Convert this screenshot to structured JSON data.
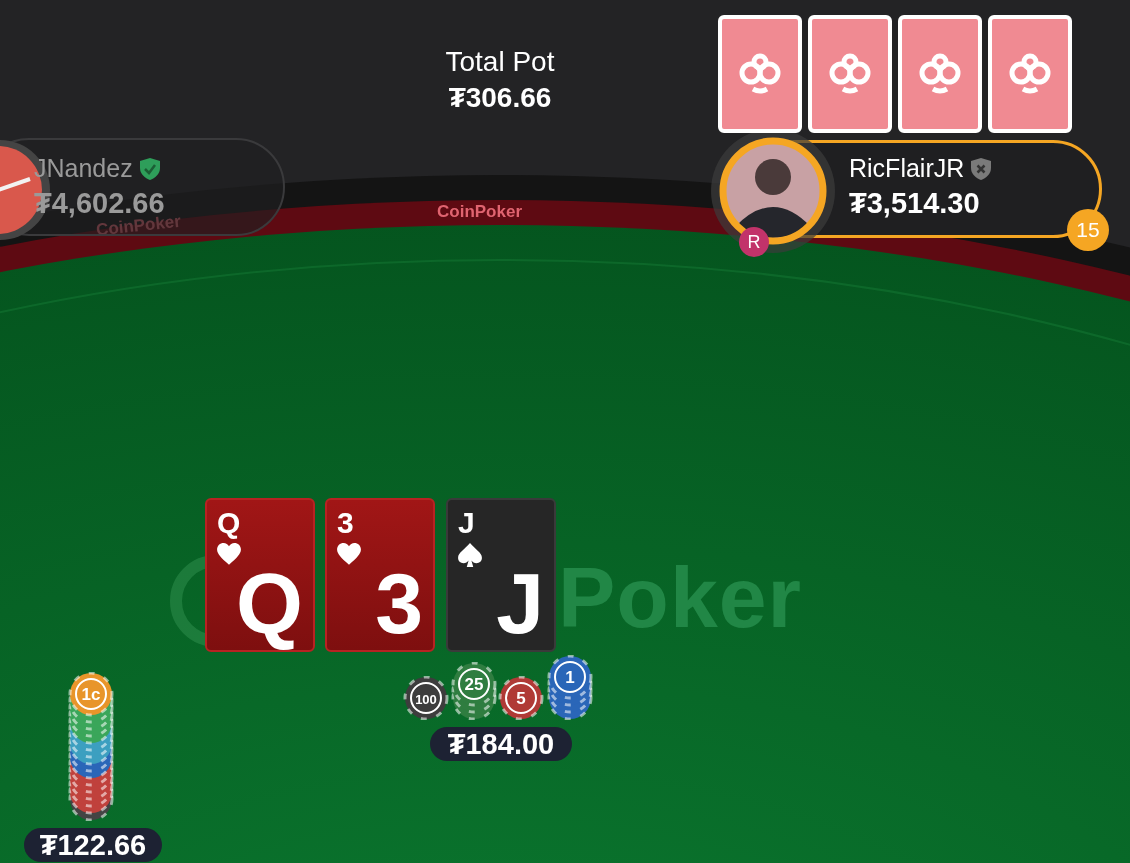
{
  "pot": {
    "label": "Total Pot",
    "amount": "₮306.66"
  },
  "rail_logos": [
    "CoinPoker",
    "CoinPoker"
  ],
  "felt_logo": {
    "text": "Poker"
  },
  "players": [
    {
      "name": "JNandez",
      "stack": "₮4,602.66",
      "verified": true,
      "active": false
    },
    {
      "name": "RicFlairJR",
      "stack": "₮3,514.30",
      "verified": false,
      "active": true,
      "timer": "15",
      "badge": "R",
      "face_down_cards": [
        {
          "kind": "back"
        },
        {
          "kind": "back"
        },
        {
          "kind": "back"
        },
        {
          "kind": "back"
        }
      ]
    }
  ],
  "board": [
    {
      "corner": "Q",
      "center": "Q",
      "kind": "hearts"
    },
    {
      "corner": "3",
      "center": "3",
      "kind": "hearts"
    },
    {
      "corner": "J",
      "center": "J",
      "kind": "spades"
    }
  ],
  "bets": [
    {
      "amount": "₮184.00",
      "stacks": [
        {
          "label": "100",
          "chips": [
            {
              "color": "#3d3d3d"
            }
          ]
        },
        {
          "label": "25",
          "chips": [
            {
              "color": "#2f7d40"
            },
            {
              "color": "#2f7d40"
            },
            {
              "color": "#2f7d40"
            }
          ]
        },
        {
          "label": "5",
          "chips": [
            {
              "color": "#b03a36"
            }
          ]
        },
        {
          "label": "1",
          "chips": [
            {
              "color": "#2a66b8"
            },
            {
              "color": "#2a66b8"
            },
            {
              "color": "#2a66b8"
            },
            {
              "color": "#2a66b8"
            }
          ]
        }
      ]
    },
    {
      "amount": "₮122.66",
      "stacks": [
        {
          "label": "1c",
          "chips": [
            {
              "color": "#e8952a"
            },
            {
              "color": "#3aa65a"
            },
            {
              "color": "#3aa65a"
            },
            {
              "color": "#3aa65a"
            },
            {
              "color": "#3aa65a"
            },
            {
              "color": "#3c9fc0"
            },
            {
              "color": "#3c9fc0"
            },
            {
              "color": "#3c9fc0"
            },
            {
              "color": "#2a66b8"
            },
            {
              "color": "#2a66b8"
            },
            {
              "color": "#c0413c"
            },
            {
              "color": "#c0413c"
            },
            {
              "color": "#c0413c"
            },
            {
              "color": "#c0413c"
            },
            {
              "color": "#c0413c"
            },
            {
              "color": "#444444"
            }
          ]
        }
      ]
    }
  ]
}
